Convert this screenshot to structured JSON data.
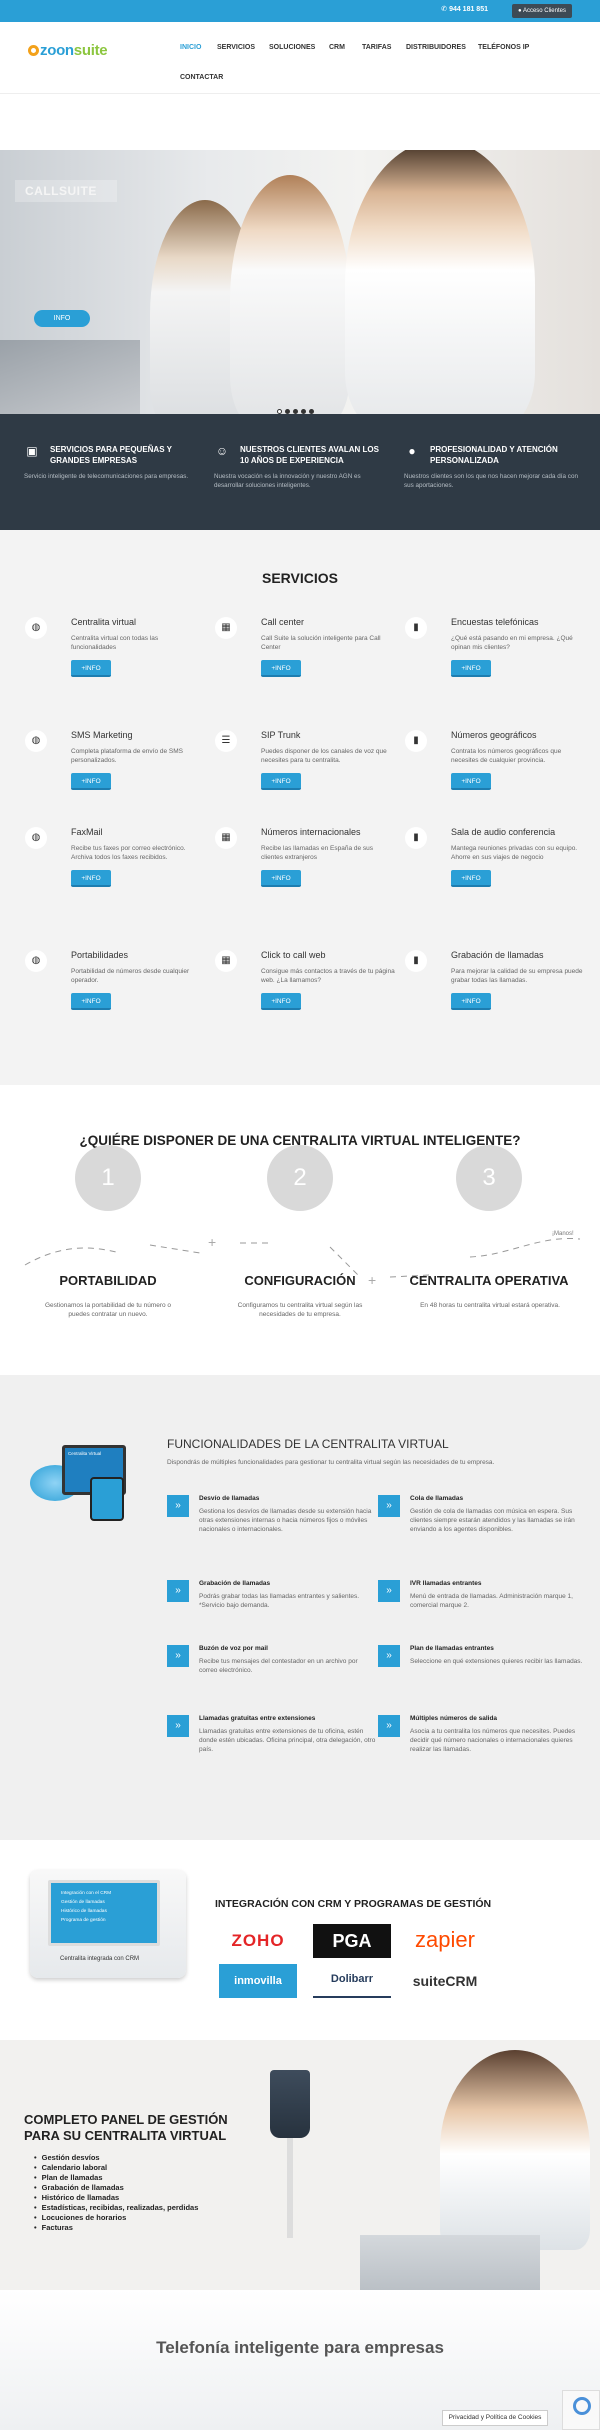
{
  "topbar": {
    "phone": "944 181 851",
    "client_button": "Acceso Clientes"
  },
  "header": {
    "logo_main": "zoon",
    "logo_accent": "suite"
  },
  "nav": [
    "INICIO",
    "SERVICIOS",
    "SOLUCIONES",
    "CRM",
    "TARIFAS",
    "DISTRIBUIDORES",
    "TELÉFONOS IP",
    "CONTACTAR"
  ],
  "hero": {
    "label": "CALLSUITE",
    "button": "INFO",
    "slides": 5,
    "active_slide": 1
  },
  "features": [
    {
      "icon": "briefcase-icon",
      "title": "SERVICIOS PARA PEQUEÑAS Y GRANDES EMPRESAS",
      "text": "Servicio inteligente de telecomunicaciones para empresas."
    },
    {
      "icon": "smile-icon",
      "title": "NUESTROS CLIENTES AVALAN LOS 10 AÑOS DE EXPERIENCIA",
      "text": "Nuestra vocación es la innovación y nuestro AGN es desarrollar soluciones inteligentes."
    },
    {
      "icon": "user-icon",
      "title": "PROFESIONALIDAD Y ATENCIÓN PERSONALIZADA",
      "text": "Nuestros clientes son los que nos hacen mejorar cada día con sus aportaciones."
    }
  ],
  "services": {
    "title": "SERVICIOS",
    "button": "+INFO",
    "items": [
      {
        "title": "Centralita virtual",
        "text": "Centralita virtual con todas las funcionalidades",
        "icon": "globe-icon"
      },
      {
        "title": "Call center",
        "text": "Call Suite la solución inteligente para Call Center",
        "icon": "grid-icon"
      },
      {
        "title": "Encuestas telefónicas",
        "text": "¿Qué está pasando en mi empresa. ¿Qué opinan mis clientes?",
        "icon": "bar-chart-icon"
      },
      {
        "title": "SMS Marketing",
        "text": "Completa plataforma de envío de SMS personalizados.",
        "icon": "globe-icon"
      },
      {
        "title": "SIP Trunk",
        "text": "Puedes disponer de los canales de voz que necesites para tu centralita.",
        "icon": "list-icon"
      },
      {
        "title": "Números geográficos",
        "text": "Contrata los números geográficos que necesites de cualquier provincia.",
        "icon": "bar-chart-icon"
      },
      {
        "title": "FaxMail",
        "text": "Recibe tus faxes por correo electrónico. Archiva todos los faxes recibidos.",
        "icon": "globe-icon"
      },
      {
        "title": "Números internacionales",
        "text": "Recibe las llamadas en España de sus clientes extranjeros",
        "icon": "grid-icon"
      },
      {
        "title": "Sala de audio conferencia",
        "text": "Mantega reuniones privadas con su equipo. Ahorre en sus viajes de negocio",
        "icon": "bar-chart-icon"
      },
      {
        "title": "Portabilidades",
        "text": "Portabilidad de números desde cualquier operador.",
        "icon": "globe-icon"
      },
      {
        "title": "Click to call web",
        "text": "Consigue más contactos a través de tu página web. ¿La llamamos?",
        "icon": "grid-icon"
      },
      {
        "title": "Grabación de llamadas",
        "text": "Para mejorar la calidad de su empresa puede grabar todas las llamadas.",
        "icon": "bar-chart-icon"
      }
    ]
  },
  "steps": {
    "title": "¿QUIÉRE DISPONER DE UNA CENTRALITA VIRTUAL INTELIGENTE?",
    "items": [
      {
        "num": "1",
        "title": "PORTABILIDAD",
        "text": "Gestionamos la portabilidad de tu número o puedes contratar un nuevo."
      },
      {
        "num": "2",
        "title": "CONFIGURACIÓN",
        "text": "Configuramos tu centralita virtual según las necesidades de tu empresa."
      },
      {
        "num": "3",
        "title": "CENTRALITA OPERATIVA",
        "text": "En 48 horas tu centralita virtual estará operativa."
      }
    ],
    "flag_text": "¡Manos!"
  },
  "functions": {
    "title": "FUNCIONALIDADES DE LA CENTRALITA VIRTUAL",
    "subtitle": "Dispondrás de múltiples funcionalidades para gestionar tu centralita virtual según las necesidades de tu empresa.",
    "device_label": "Centralita Virtual",
    "left": [
      {
        "title": "Desvío de llamadas",
        "text": "Gestiona los desvíos de llamadas desde su extensión hacia otras extensiones internas o hacia números fijos o móviles nacionales o internacionales."
      },
      {
        "title": "Grabación de llamadas",
        "text": "Podrás grabar todas las llamadas entrantes y salientes. *Servicio bajo demanda."
      },
      {
        "title": "Buzón de voz por mail",
        "text": "Recibe tus mensajes del contestador en un archivo por correo electrónico."
      },
      {
        "title": "Llamadas gratuitas entre extensiones",
        "text": "Llamadas gratuitas entre extensiones de tu oficina, estén donde estén ubicadas. Oficina principal, otra delegación, otro país."
      }
    ],
    "right": [
      {
        "title": "Cola de llamadas",
        "text": "Gestión de cola de llamadas con música en espera. Sus clientes siempre estarán atendidos y las llamadas se irán enviando a los agentes disponibles."
      },
      {
        "title": "IVR llamadas entrantes",
        "text": "Menú de entrada de llamadas. Administración marque 1, comercial marque 2."
      },
      {
        "title": "Plan de llamadas entrantes",
        "text": "Seleccione en qué extensiones quieres recibir las llamadas."
      },
      {
        "title": "Múltiples números de salida",
        "text": "Asocia a tu centralita los números que necesites. Puedes decidir qué número nacionales o internacionales quieres realizar las llamadas."
      }
    ]
  },
  "crm": {
    "title": "INTEGRACIÓN CON CRM Y PROGRAMAS DE GESTIÓN",
    "monitor_caption": "Centralita integrada con CRM",
    "monitor_lines": [
      "Integración con el CRM",
      "Gestión de llamadas",
      "Histórico de llamadas",
      "Programa de gestión"
    ],
    "logos": [
      {
        "text": "ZOHO",
        "color": "#e42527"
      },
      {
        "text": "PGA",
        "color": "#ffffff"
      },
      {
        "text": "zapier",
        "color": "#ff4a00"
      },
      {
        "text": "inmovilla",
        "color": "#ffffff"
      },
      {
        "text": "Dolibarr",
        "color": "#263c5c"
      },
      {
        "text": "suiteCRM",
        "color": "#333333"
      }
    ]
  },
  "panel": {
    "title": "COMPLETO PANEL DE GESTIÓN PARA SU CENTRALITA VIRTUAL",
    "items": [
      "Gestión desvíos",
      "Calendario laboral",
      "Plan de llamadas",
      "Grabación de llamadas",
      "Histórico de llamadas",
      "Estadísticas, recibidas, realizadas, perdidas",
      "Locuciones de horarios",
      "Facturas"
    ]
  },
  "bottom": {
    "title": "Telefonía inteligente para empresas"
  },
  "cookie": {
    "label": "Privacidad y Política de Cookies"
  },
  "colors": {
    "accent": "#2a9fd6",
    "dark": "#2f3a45"
  }
}
